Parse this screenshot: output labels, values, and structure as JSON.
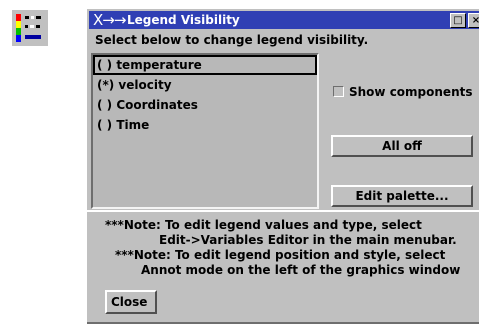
{
  "window": {
    "title": "Legend Visibility",
    "sys_icon": "X→→",
    "maximize_symbol": "□",
    "close_symbol": "×"
  },
  "instruction": "Select below to change legend visibility.",
  "legend_list": {
    "items": [
      {
        "label": "( ) temperature",
        "selected": true
      },
      {
        "label": "(*) velocity",
        "selected": false
      },
      {
        "label": "( ) Coordinates",
        "selected": false
      },
      {
        "label": "( ) Time",
        "selected": false
      }
    ]
  },
  "show_components": {
    "label": "Show components",
    "checked": false
  },
  "buttons": {
    "all_off": "All off",
    "edit_palette": "Edit palette...",
    "close": "Close"
  },
  "notes": [
    "***Note: To edit legend values and type, select",
    "Edit->Variables Editor in the main menubar.",
    "***Note: To edit legend position and style, select",
    "Annot mode on the left of the graphics window"
  ],
  "colors": {
    "title_bar": "#2f3fb4",
    "dialog_bg": "#c0c0c0",
    "list_bg": "#b8b8b8"
  },
  "icons": [
    "legend-app-icon",
    "system-menu-icon",
    "maximize-icon",
    "close-icon",
    "checkbox-icon"
  ]
}
